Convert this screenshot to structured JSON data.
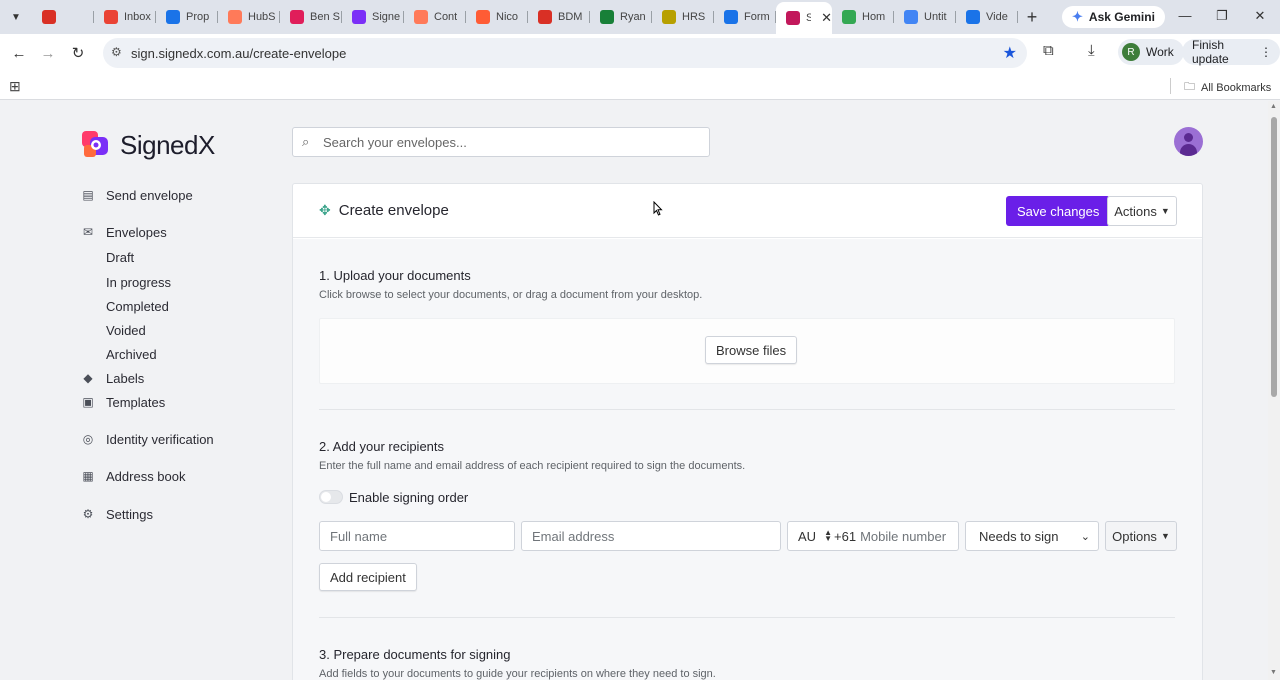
{
  "browser": {
    "tabs": [
      {
        "title": "",
        "color": "#d93025"
      },
      {
        "title": "Inbox",
        "color": "#ea4335"
      },
      {
        "title": "Prop",
        "color": "#1a73e8"
      },
      {
        "title": "HubS",
        "color": "#ff7a59"
      },
      {
        "title": "Ben S",
        "color": "#e01e5a"
      },
      {
        "title": "Signe",
        "color": "#7b2ff7"
      },
      {
        "title": "Cont",
        "color": "#ff7a59"
      },
      {
        "title": "Nico",
        "color": "#ff5c35"
      },
      {
        "title": "BDM",
        "color": "#d93025"
      },
      {
        "title": "Ryan",
        "color": "#188038"
      },
      {
        "title": "HRS",
        "color": "#b7a000"
      },
      {
        "title": "Form",
        "color": "#1a73e8"
      }
    ],
    "active_tab": {
      "title": "S",
      "color": "#c2185b"
    },
    "tabs_after": [
      {
        "title": "Hom",
        "color": "#34a853"
      },
      {
        "title": "Untit",
        "color": "#4285f4"
      },
      {
        "title": "Vide",
        "color": "#1a73e8"
      }
    ],
    "ask_gemini": "Ask Gemini",
    "url": "sign.signedx.com.au/create-envelope",
    "profile_initial": "R",
    "profile_label": "Work",
    "finish_update": "Finish update",
    "all_bookmarks": "All Bookmarks"
  },
  "app": {
    "logo_text": "SignedX",
    "search_placeholder": "Search your envelopes...",
    "brand_color": "#6a1fe8"
  },
  "sidebar": {
    "send_envelope": "Send envelope",
    "envelopes": "Envelopes",
    "sub": [
      "Draft",
      "In progress",
      "Completed",
      "Voided",
      "Archived"
    ],
    "labels": "Labels",
    "templates": "Templates",
    "identity_verification": "Identity verification",
    "address_book": "Address book",
    "settings": "Settings"
  },
  "envelope": {
    "title": "Create envelope",
    "save_changes": "Save changes",
    "actions": "Actions",
    "step1": {
      "title": "1. Upload your documents",
      "desc": "Click browse to select your documents, or drag a document from your desktop.",
      "browse": "Browse files"
    },
    "step2": {
      "title": "2. Add your recipients",
      "desc": "Enter the full name and email address of each recipient required to sign the documents.",
      "signing_order": "Enable signing order",
      "full_name_placeholder": "Full name",
      "email_placeholder": "Email address",
      "country": "AU",
      "prefix": "+61",
      "mobile_placeholder": "Mobile number",
      "role": "Needs to sign",
      "options": "Options",
      "add_recipient": "Add recipient"
    },
    "step3": {
      "title": "3. Prepare documents for signing",
      "desc": "Add fields to your documents to guide your recipients on where they need to sign."
    }
  }
}
